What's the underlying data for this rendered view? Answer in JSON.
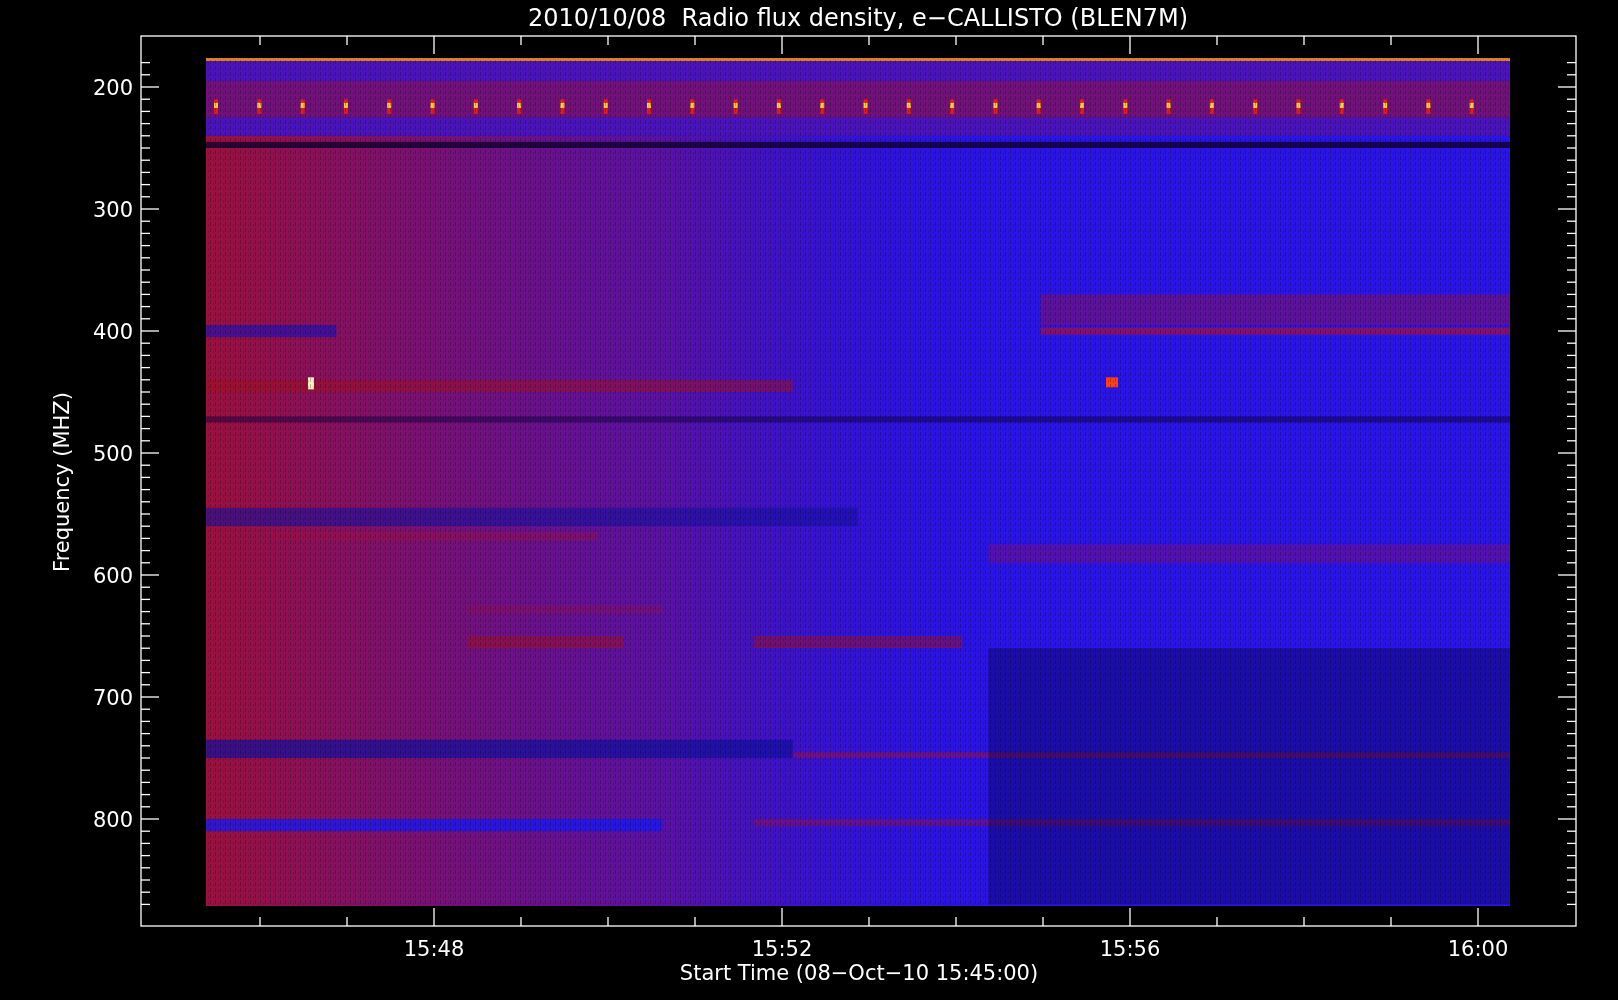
{
  "title": "2010/10/08  Radio flux density, e−CALLISTO (BLEN7M)",
  "y_axis": {
    "label": "Frequency (MHZ)",
    "ticks": [
      "200",
      "300",
      "400",
      "500",
      "600",
      "700",
      "800"
    ]
  },
  "x_axis": {
    "label": "Start Time (08−Oct−10 15:45:00)",
    "ticks": [
      "15:48",
      "15:52",
      "15:56",
      "16:00"
    ]
  }
}
